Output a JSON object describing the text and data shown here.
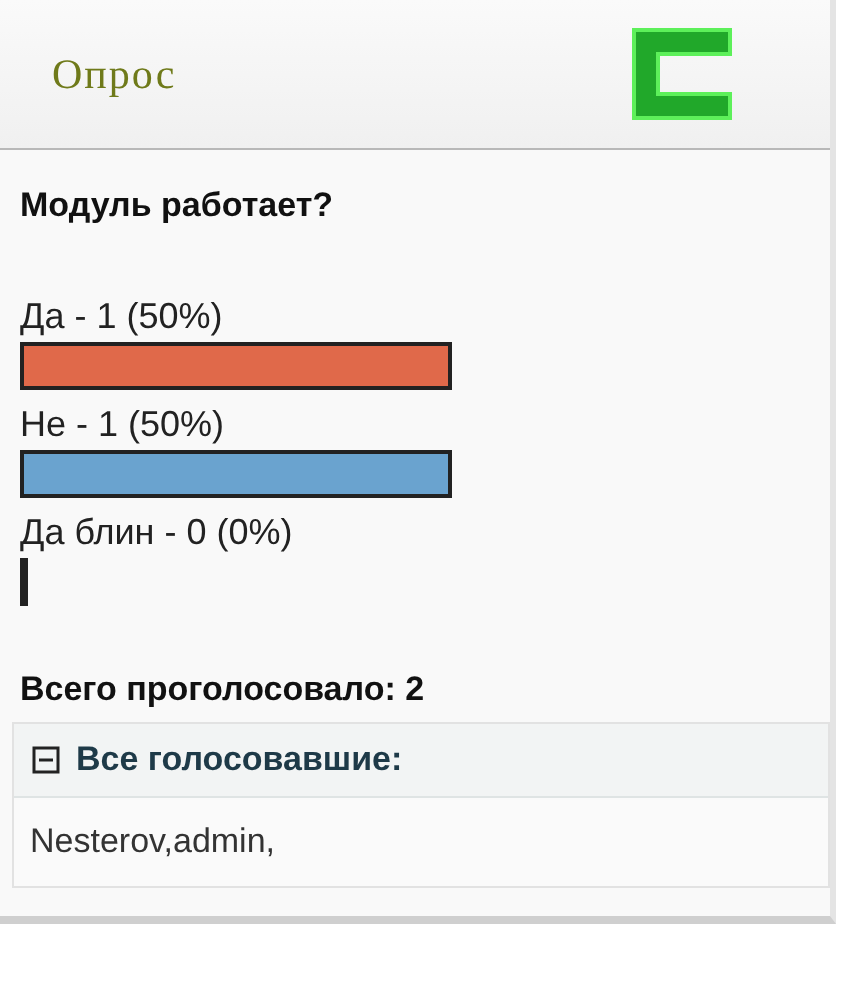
{
  "module": {
    "title": "Опрос"
  },
  "poll": {
    "question": "Модуль работает?",
    "options": [
      {
        "label": "Да - 1 (50%)",
        "kind": "bar",
        "color": "#e0694a"
      },
      {
        "label": "Не - 1 (50%)",
        "kind": "bar",
        "color": "#6aa3cf"
      },
      {
        "label": "Да блин - 0 (0%)",
        "kind": "empty",
        "color": "#222222"
      }
    ],
    "total": "Всего проголосовало: 2"
  },
  "voters": {
    "title": "Все голосовавшие:",
    "expanded": true,
    "list": "Nesterov,admin,"
  }
}
